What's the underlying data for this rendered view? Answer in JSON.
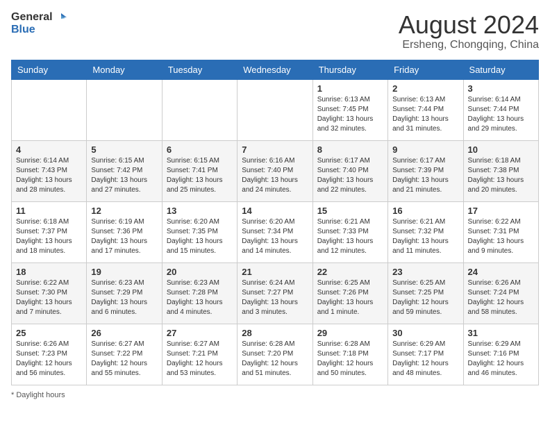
{
  "header": {
    "logo_general": "General",
    "logo_blue": "Blue",
    "title": "August 2024",
    "location": "Ersheng, Chongqing, China"
  },
  "weekdays": [
    "Sunday",
    "Monday",
    "Tuesday",
    "Wednesday",
    "Thursday",
    "Friday",
    "Saturday"
  ],
  "weeks": [
    [
      {
        "day": "",
        "info": ""
      },
      {
        "day": "",
        "info": ""
      },
      {
        "day": "",
        "info": ""
      },
      {
        "day": "",
        "info": ""
      },
      {
        "day": "1",
        "info": "Sunrise: 6:13 AM\nSunset: 7:45 PM\nDaylight: 13 hours and 32 minutes."
      },
      {
        "day": "2",
        "info": "Sunrise: 6:13 AM\nSunset: 7:44 PM\nDaylight: 13 hours and 31 minutes."
      },
      {
        "day": "3",
        "info": "Sunrise: 6:14 AM\nSunset: 7:44 PM\nDaylight: 13 hours and 29 minutes."
      }
    ],
    [
      {
        "day": "4",
        "info": "Sunrise: 6:14 AM\nSunset: 7:43 PM\nDaylight: 13 hours and 28 minutes."
      },
      {
        "day": "5",
        "info": "Sunrise: 6:15 AM\nSunset: 7:42 PM\nDaylight: 13 hours and 27 minutes."
      },
      {
        "day": "6",
        "info": "Sunrise: 6:15 AM\nSunset: 7:41 PM\nDaylight: 13 hours and 25 minutes."
      },
      {
        "day": "7",
        "info": "Sunrise: 6:16 AM\nSunset: 7:40 PM\nDaylight: 13 hours and 24 minutes."
      },
      {
        "day": "8",
        "info": "Sunrise: 6:17 AM\nSunset: 7:40 PM\nDaylight: 13 hours and 22 minutes."
      },
      {
        "day": "9",
        "info": "Sunrise: 6:17 AM\nSunset: 7:39 PM\nDaylight: 13 hours and 21 minutes."
      },
      {
        "day": "10",
        "info": "Sunrise: 6:18 AM\nSunset: 7:38 PM\nDaylight: 13 hours and 20 minutes."
      }
    ],
    [
      {
        "day": "11",
        "info": "Sunrise: 6:18 AM\nSunset: 7:37 PM\nDaylight: 13 hours and 18 minutes."
      },
      {
        "day": "12",
        "info": "Sunrise: 6:19 AM\nSunset: 7:36 PM\nDaylight: 13 hours and 17 minutes."
      },
      {
        "day": "13",
        "info": "Sunrise: 6:20 AM\nSunset: 7:35 PM\nDaylight: 13 hours and 15 minutes."
      },
      {
        "day": "14",
        "info": "Sunrise: 6:20 AM\nSunset: 7:34 PM\nDaylight: 13 hours and 14 minutes."
      },
      {
        "day": "15",
        "info": "Sunrise: 6:21 AM\nSunset: 7:33 PM\nDaylight: 13 hours and 12 minutes."
      },
      {
        "day": "16",
        "info": "Sunrise: 6:21 AM\nSunset: 7:32 PM\nDaylight: 13 hours and 11 minutes."
      },
      {
        "day": "17",
        "info": "Sunrise: 6:22 AM\nSunset: 7:31 PM\nDaylight: 13 hours and 9 minutes."
      }
    ],
    [
      {
        "day": "18",
        "info": "Sunrise: 6:22 AM\nSunset: 7:30 PM\nDaylight: 13 hours and 7 minutes."
      },
      {
        "day": "19",
        "info": "Sunrise: 6:23 AM\nSunset: 7:29 PM\nDaylight: 13 hours and 6 minutes."
      },
      {
        "day": "20",
        "info": "Sunrise: 6:23 AM\nSunset: 7:28 PM\nDaylight: 13 hours and 4 minutes."
      },
      {
        "day": "21",
        "info": "Sunrise: 6:24 AM\nSunset: 7:27 PM\nDaylight: 13 hours and 3 minutes."
      },
      {
        "day": "22",
        "info": "Sunrise: 6:25 AM\nSunset: 7:26 PM\nDaylight: 13 hours and 1 minute."
      },
      {
        "day": "23",
        "info": "Sunrise: 6:25 AM\nSunset: 7:25 PM\nDaylight: 12 hours and 59 minutes."
      },
      {
        "day": "24",
        "info": "Sunrise: 6:26 AM\nSunset: 7:24 PM\nDaylight: 12 hours and 58 minutes."
      }
    ],
    [
      {
        "day": "25",
        "info": "Sunrise: 6:26 AM\nSunset: 7:23 PM\nDaylight: 12 hours and 56 minutes."
      },
      {
        "day": "26",
        "info": "Sunrise: 6:27 AM\nSunset: 7:22 PM\nDaylight: 12 hours and 55 minutes."
      },
      {
        "day": "27",
        "info": "Sunrise: 6:27 AM\nSunset: 7:21 PM\nDaylight: 12 hours and 53 minutes."
      },
      {
        "day": "28",
        "info": "Sunrise: 6:28 AM\nSunset: 7:20 PM\nDaylight: 12 hours and 51 minutes."
      },
      {
        "day": "29",
        "info": "Sunrise: 6:28 AM\nSunset: 7:18 PM\nDaylight: 12 hours and 50 minutes."
      },
      {
        "day": "30",
        "info": "Sunrise: 6:29 AM\nSunset: 7:17 PM\nDaylight: 12 hours and 48 minutes."
      },
      {
        "day": "31",
        "info": "Sunrise: 6:29 AM\nSunset: 7:16 PM\nDaylight: 12 hours and 46 minutes."
      }
    ]
  ],
  "footer": {
    "note": "Daylight hours"
  },
  "colors": {
    "header_bg": "#2a6db5",
    "logo_blue": "#2a6db5"
  }
}
